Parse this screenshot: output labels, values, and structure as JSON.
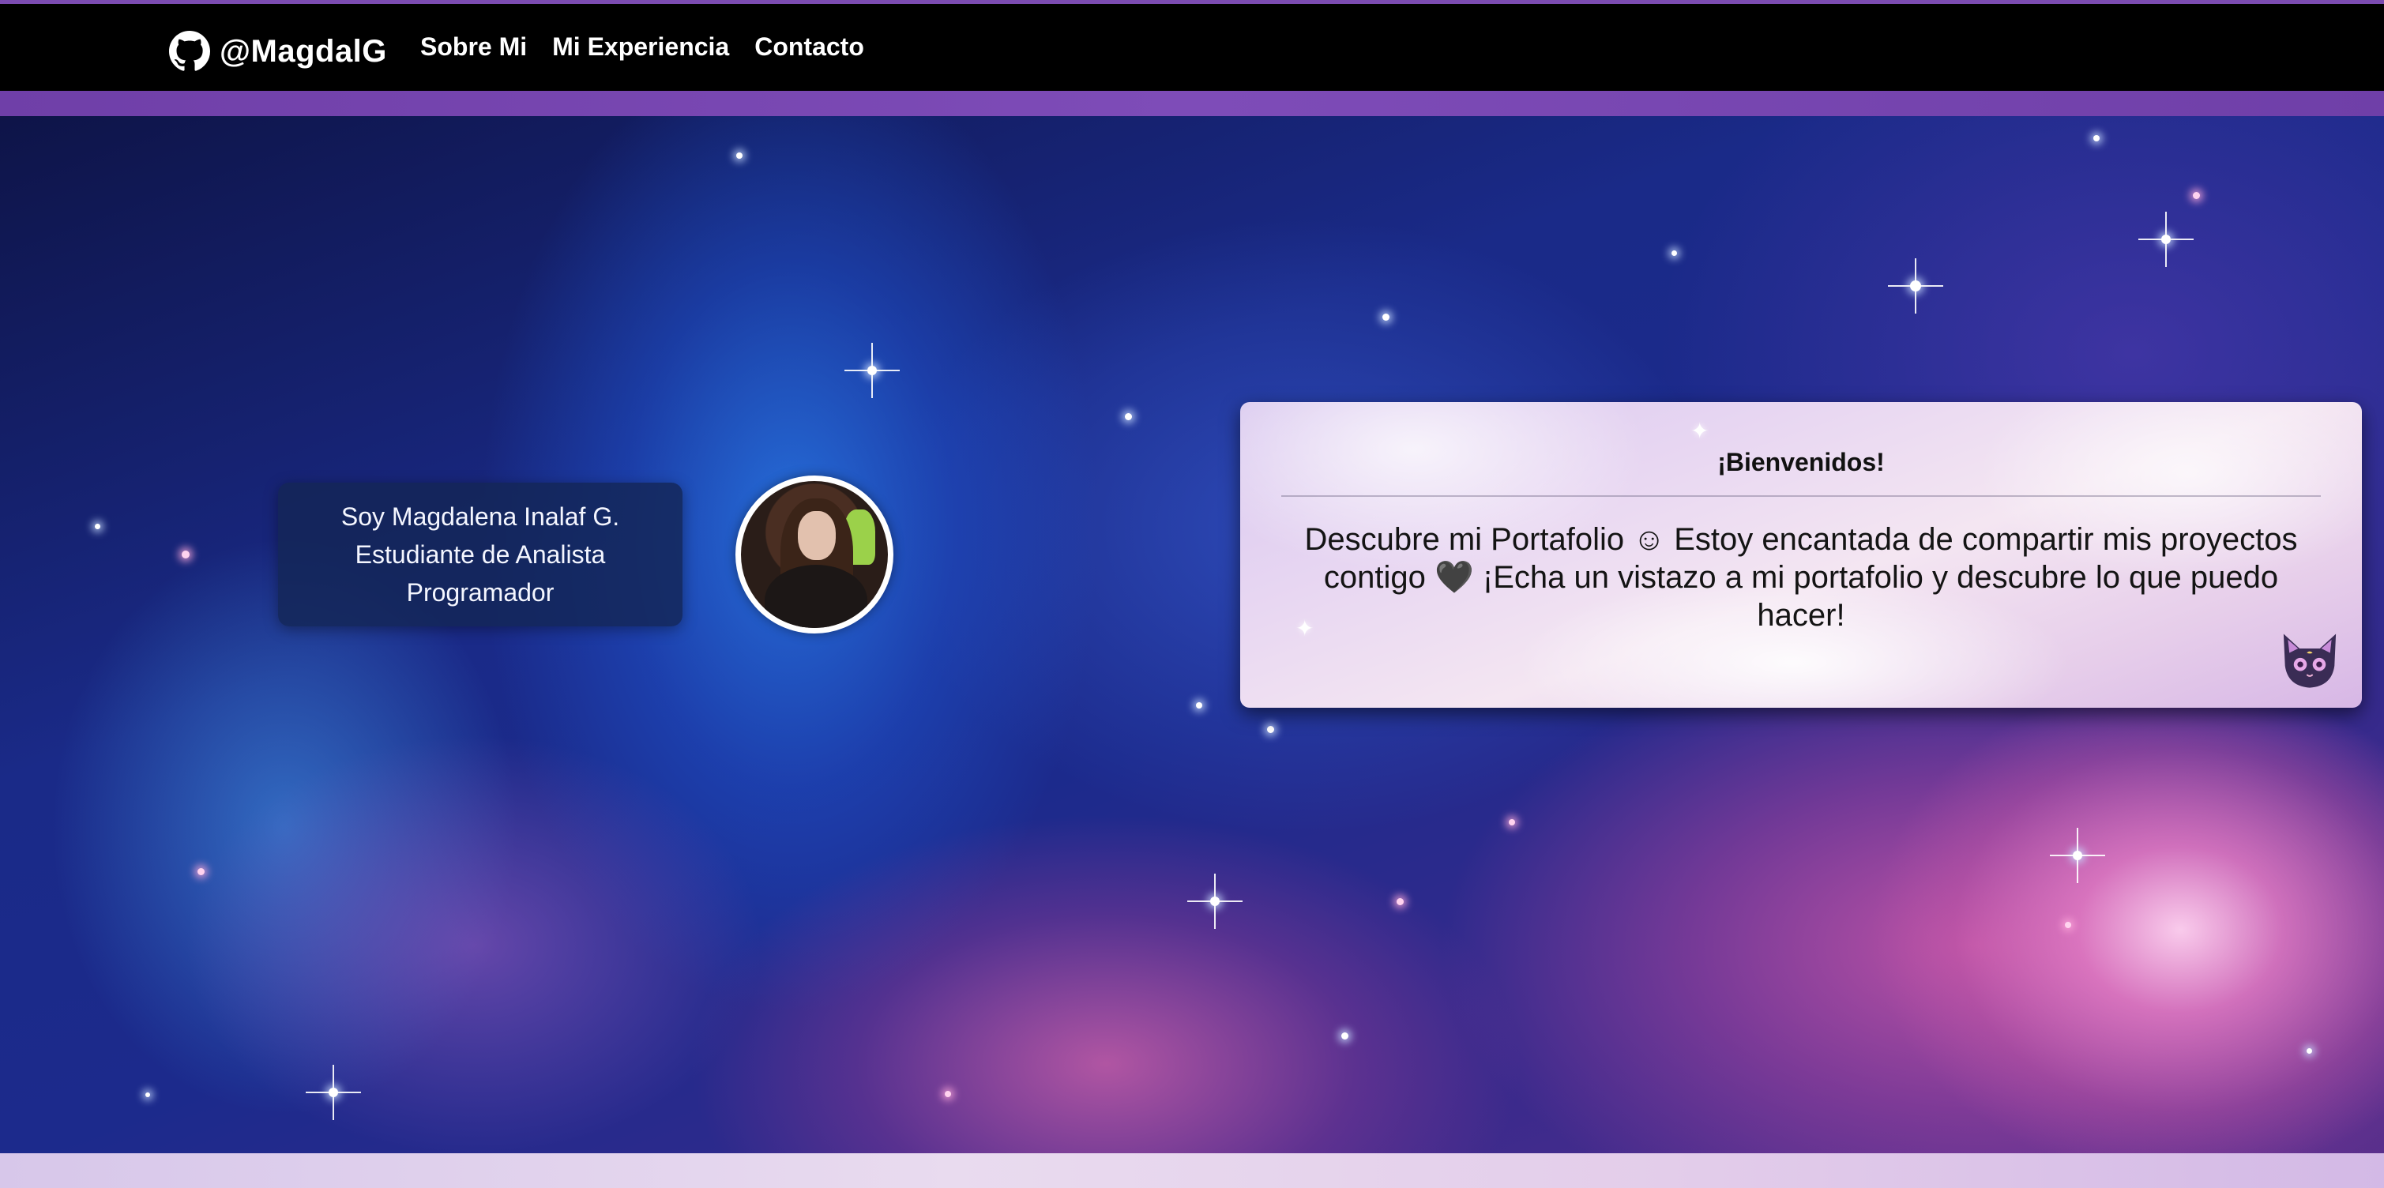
{
  "navbar": {
    "brand_label": "@MagdalG",
    "brand_icon": "github-icon",
    "links": [
      {
        "label": "Sobre Mi"
      },
      {
        "label": "Mi Experiencia"
      },
      {
        "label": "Contacto"
      }
    ]
  },
  "intro": {
    "line1": "Soy Magdalena Inalaf G.",
    "line2": "Estudiante de Analista",
    "line3": "Programador"
  },
  "welcome": {
    "title": "¡Bienvenidos!",
    "body": "Descubre mi Portafolio ☺ Estoy encantada de compartir mis proyectos contigo 🖤 ¡Echa un vistazo a mi portafolio y descubre lo que puedo hacer!",
    "mascot_icon": "cat-icon"
  },
  "colors": {
    "accent": "#7b4bb0",
    "navbar_bg": "#000000",
    "intro_bg": "#142655"
  }
}
